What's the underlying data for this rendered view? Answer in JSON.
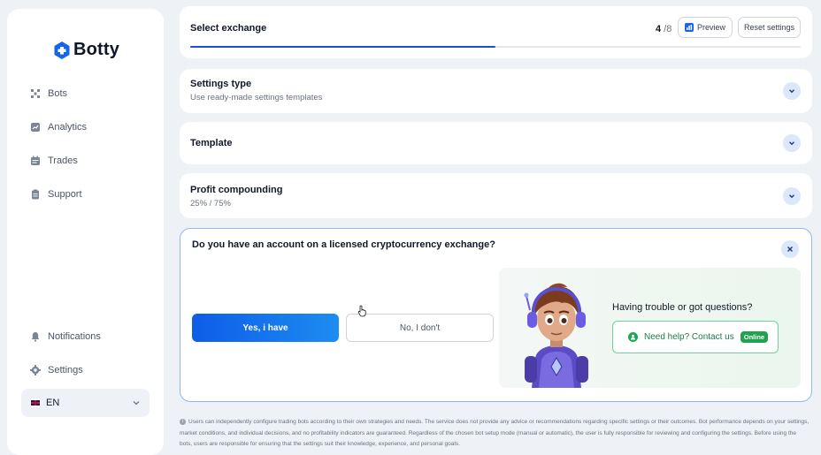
{
  "brand": {
    "name": "Botty",
    "accent": "#1565e8"
  },
  "sidebar": {
    "items": [
      {
        "label": "Bots",
        "icon": "bots-icon"
      },
      {
        "label": "Analytics",
        "icon": "analytics-icon"
      },
      {
        "label": "Trades",
        "icon": "trades-icon"
      },
      {
        "label": "Support",
        "icon": "support-icon"
      }
    ],
    "bottom_items": [
      {
        "label": "Notifications",
        "icon": "bell-icon"
      },
      {
        "label": "Settings",
        "icon": "gear-icon"
      }
    ],
    "language": {
      "code": "EN",
      "flag": "uk-flag-icon"
    }
  },
  "header": {
    "title": "Select exchange",
    "step_current": "4",
    "step_total": "/8",
    "progress_fraction": 0.5,
    "preview_label": "Preview",
    "reset_label": "Reset settings"
  },
  "sections": [
    {
      "title": "Settings type",
      "subtitle": "Use ready-made settings templates"
    },
    {
      "title": "Template",
      "subtitle": ""
    },
    {
      "title": "Profit compounding",
      "subtitle": "25% / 75%"
    }
  ],
  "question": {
    "title": "Do you have an account on a licensed cryptocurrency exchange?",
    "yes_label": "Yes, i have",
    "no_label": "No, I don't",
    "help_title": "Having trouble or got questions?",
    "help_button_label": "Need help? Contact us",
    "online_label": "Online"
  },
  "disclaimer": "Users can independently configure trading bots according to their own strategies and needs. The service does not provide any advice or recommendations regarding specific settings or their outcomes. Bot performance depends on your settings, market conditions, and individual decisions, and no profitability indicators are guaranteed. Regardless of the chosen bot setup mode (manual or automatic), the user is fully responsible for reviewing and configuring the settings. Before using the bots, users are responsible for ensuring that the settings suit their knowledge, experience, and personal goals."
}
